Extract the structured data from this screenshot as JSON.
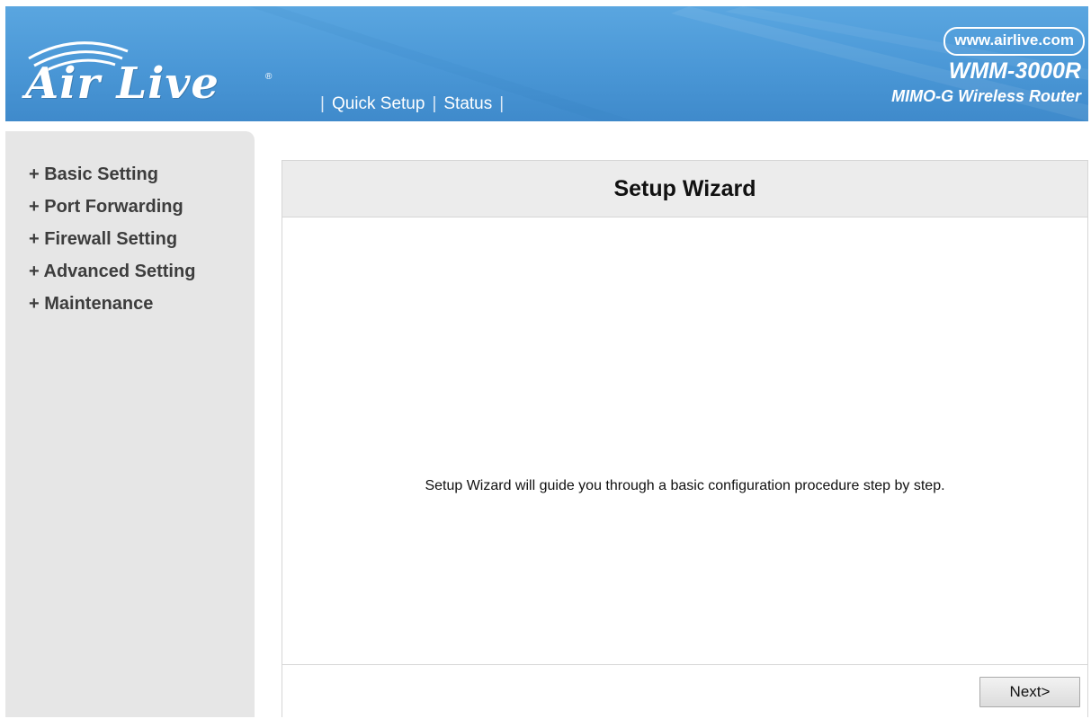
{
  "header": {
    "logo_text": "Air Live",
    "logo_reg": "®",
    "nav": [
      {
        "label": "Quick Setup"
      },
      {
        "label": "Status"
      }
    ],
    "brand_url": "www.airlive.com",
    "model": "WMM-3000R",
    "model_description": "MIMO-G Wireless Router"
  },
  "sidebar": {
    "items": [
      {
        "label": "+ Basic Setting"
      },
      {
        "label": "+ Port Forwarding"
      },
      {
        "label": "+ Firewall Setting"
      },
      {
        "label": "+ Advanced Setting"
      },
      {
        "label": "+ Maintenance"
      }
    ]
  },
  "main": {
    "title": "Setup Wizard",
    "description": "Setup Wizard will guide you through a basic configuration procedure step by step.",
    "next_label": "Next>"
  },
  "colors": {
    "banner": "#4a97d6",
    "sidebar": "#e6e6e6",
    "panel_header": "#ececec"
  },
  "icons": [
    "airlive-logo-icon"
  ]
}
